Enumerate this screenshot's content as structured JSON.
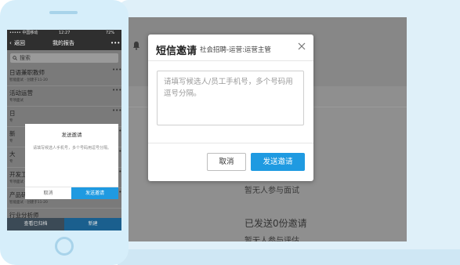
{
  "desktop": {
    "modal": {
      "title": "短信邀请",
      "subtitle": "社会招聘-运营:运营主管",
      "placeholder": "请填写候选人/员工手机号，多个号码用逗号分隔。",
      "cancel_label": "取消",
      "send_label": "发送邀请"
    },
    "background": {
      "no_interview_text": "暂无人参与面试",
      "sent_heading": "已发送0份邀请",
      "no_eval_text": "暂无人参与评估"
    }
  },
  "phone": {
    "status": {
      "carrier": "••••• 中国移动",
      "time": "12:27",
      "battery": "72%"
    },
    "nav": {
      "back_label": "返回",
      "title": "我的报告",
      "more": "•••"
    },
    "search_placeholder": "搜索",
    "list": [
      {
        "title": "日语兼职教师",
        "meta": "智能面试 · 创建于11-20",
        "right": "",
        "dots": "•••"
      },
      {
        "title": "活动运营",
        "meta": "专项面试",
        "right": "",
        "dots": "•••"
      },
      {
        "title": "日",
        "meta": "专",
        "right": "",
        "dots": "•••"
      },
      {
        "title": "新",
        "meta": "专",
        "right": "",
        "dots": "•••"
      },
      {
        "title": "大",
        "meta": "专",
        "right": "",
        "dots": "•••"
      },
      {
        "title": "开发工程师",
        "meta": "专项面试 · 创建于07-11",
        "right": "邀请人数 10/12",
        "dots": "•••"
      },
      {
        "title": "产品研发",
        "meta": "智能面试 · 创建于11-20",
        "right": "",
        "dots": "•••"
      },
      {
        "title": "行业分析师",
        "meta": "",
        "right": "",
        "dots": ""
      }
    ],
    "bottom": {
      "left_label": "查看已归档",
      "right_label": "新建"
    },
    "dialog": {
      "title": "发送邀请",
      "body": "请填写候选人手机号，多个号码用逗号分隔。",
      "cancel_label": "取消",
      "send_label": "发送邀请"
    }
  },
  "colors": {
    "accent": "#1f9ae1",
    "overlay": "#878787",
    "device_frame": "#d6eefa"
  }
}
